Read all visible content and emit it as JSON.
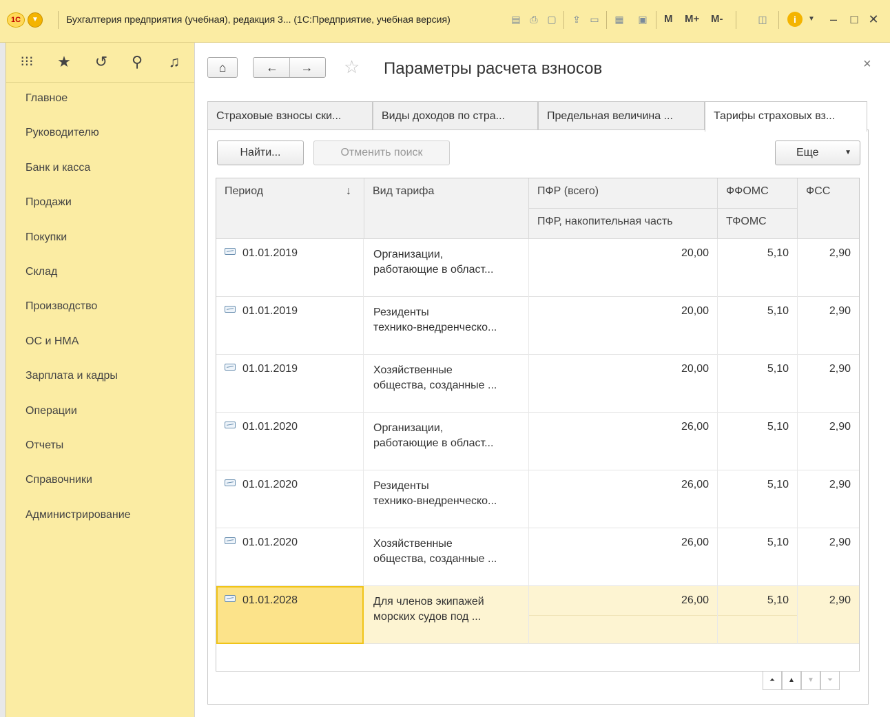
{
  "window": {
    "title": "Бухгалтерия предприятия (учебная), редакция 3... (1С:Предприятие, учебная версия)",
    "toolbar_labels": {
      "m": "M",
      "m_plus": "M+",
      "m_minus": "M-"
    },
    "logo_text": "1С"
  },
  "sidebar": {
    "items": [
      {
        "label": "Главное"
      },
      {
        "label": "Руководителю"
      },
      {
        "label": "Банк и касса"
      },
      {
        "label": "Продажи"
      },
      {
        "label": "Покупки"
      },
      {
        "label": "Склад"
      },
      {
        "label": "Производство"
      },
      {
        "label": "ОС и НМА"
      },
      {
        "label": "Зарплата и кадры"
      },
      {
        "label": "Операции"
      },
      {
        "label": "Отчеты"
      },
      {
        "label": "Справочники"
      },
      {
        "label": "Администрирование"
      }
    ],
    "icons": [
      "apps-grid-icon",
      "favorites-star-icon",
      "history-icon",
      "search-icon",
      "notifications-bell-icon"
    ]
  },
  "page": {
    "title": "Параметры расчета взносов",
    "tabs": [
      {
        "label": "Страховые взносы ски..."
      },
      {
        "label": "Виды доходов по стра..."
      },
      {
        "label": "Предельная величина ..."
      },
      {
        "label": "Тарифы страховых вз..."
      }
    ],
    "active_tab": 3,
    "buttons": {
      "find": "Найти...",
      "cancel_search": "Отменить поиск",
      "more": "Еще"
    }
  },
  "table": {
    "headers": {
      "period": "Период",
      "vid": "Вид тарифа",
      "pfr_total": "ПФР (всего)",
      "pfr_nakop": "ПФР, накопительная часть",
      "ffoms": "ФФОМС",
      "tfoms": "ТФОМС",
      "fss": "ФСС",
      "sort_indicator": "↓"
    },
    "rows": [
      {
        "period": "01.01.2019",
        "vid1": "Организации,",
        "vid2": "работающие в област...",
        "pfr": "20,00",
        "ffoms": "5,10",
        "fss": "2,90"
      },
      {
        "period": "01.01.2019",
        "vid1": "Резиденты",
        "vid2": "технико-внедренческо...",
        "pfr": "20,00",
        "ffoms": "5,10",
        "fss": "2,90"
      },
      {
        "period": "01.01.2019",
        "vid1": "Хозяйственные",
        "vid2": "общества, созданные ...",
        "pfr": "20,00",
        "ffoms": "5,10",
        "fss": "2,90"
      },
      {
        "period": "01.01.2020",
        "vid1": "Организации,",
        "vid2": "работающие в област...",
        "pfr": "26,00",
        "ffoms": "5,10",
        "fss": "2,90"
      },
      {
        "period": "01.01.2020",
        "vid1": "Резиденты",
        "vid2": "технико-внедренческо...",
        "pfr": "26,00",
        "ffoms": "5,10",
        "fss": "2,90"
      },
      {
        "period": "01.01.2020",
        "vid1": "Хозяйственные",
        "vid2": "общества, созданные ...",
        "pfr": "26,00",
        "ffoms": "5,10",
        "fss": "2,90"
      },
      {
        "period": "01.01.2028",
        "vid1": "Для членов экипажей",
        "vid2": "морских судов под ...",
        "pfr": "26,00",
        "ffoms": "5,10",
        "fss": "2,90"
      }
    ],
    "selected_row": 6
  },
  "colors": {
    "panel_yellow": "#fbeca3",
    "selection_yellow": "#fce38a",
    "selection_border": "#f0c419"
  }
}
